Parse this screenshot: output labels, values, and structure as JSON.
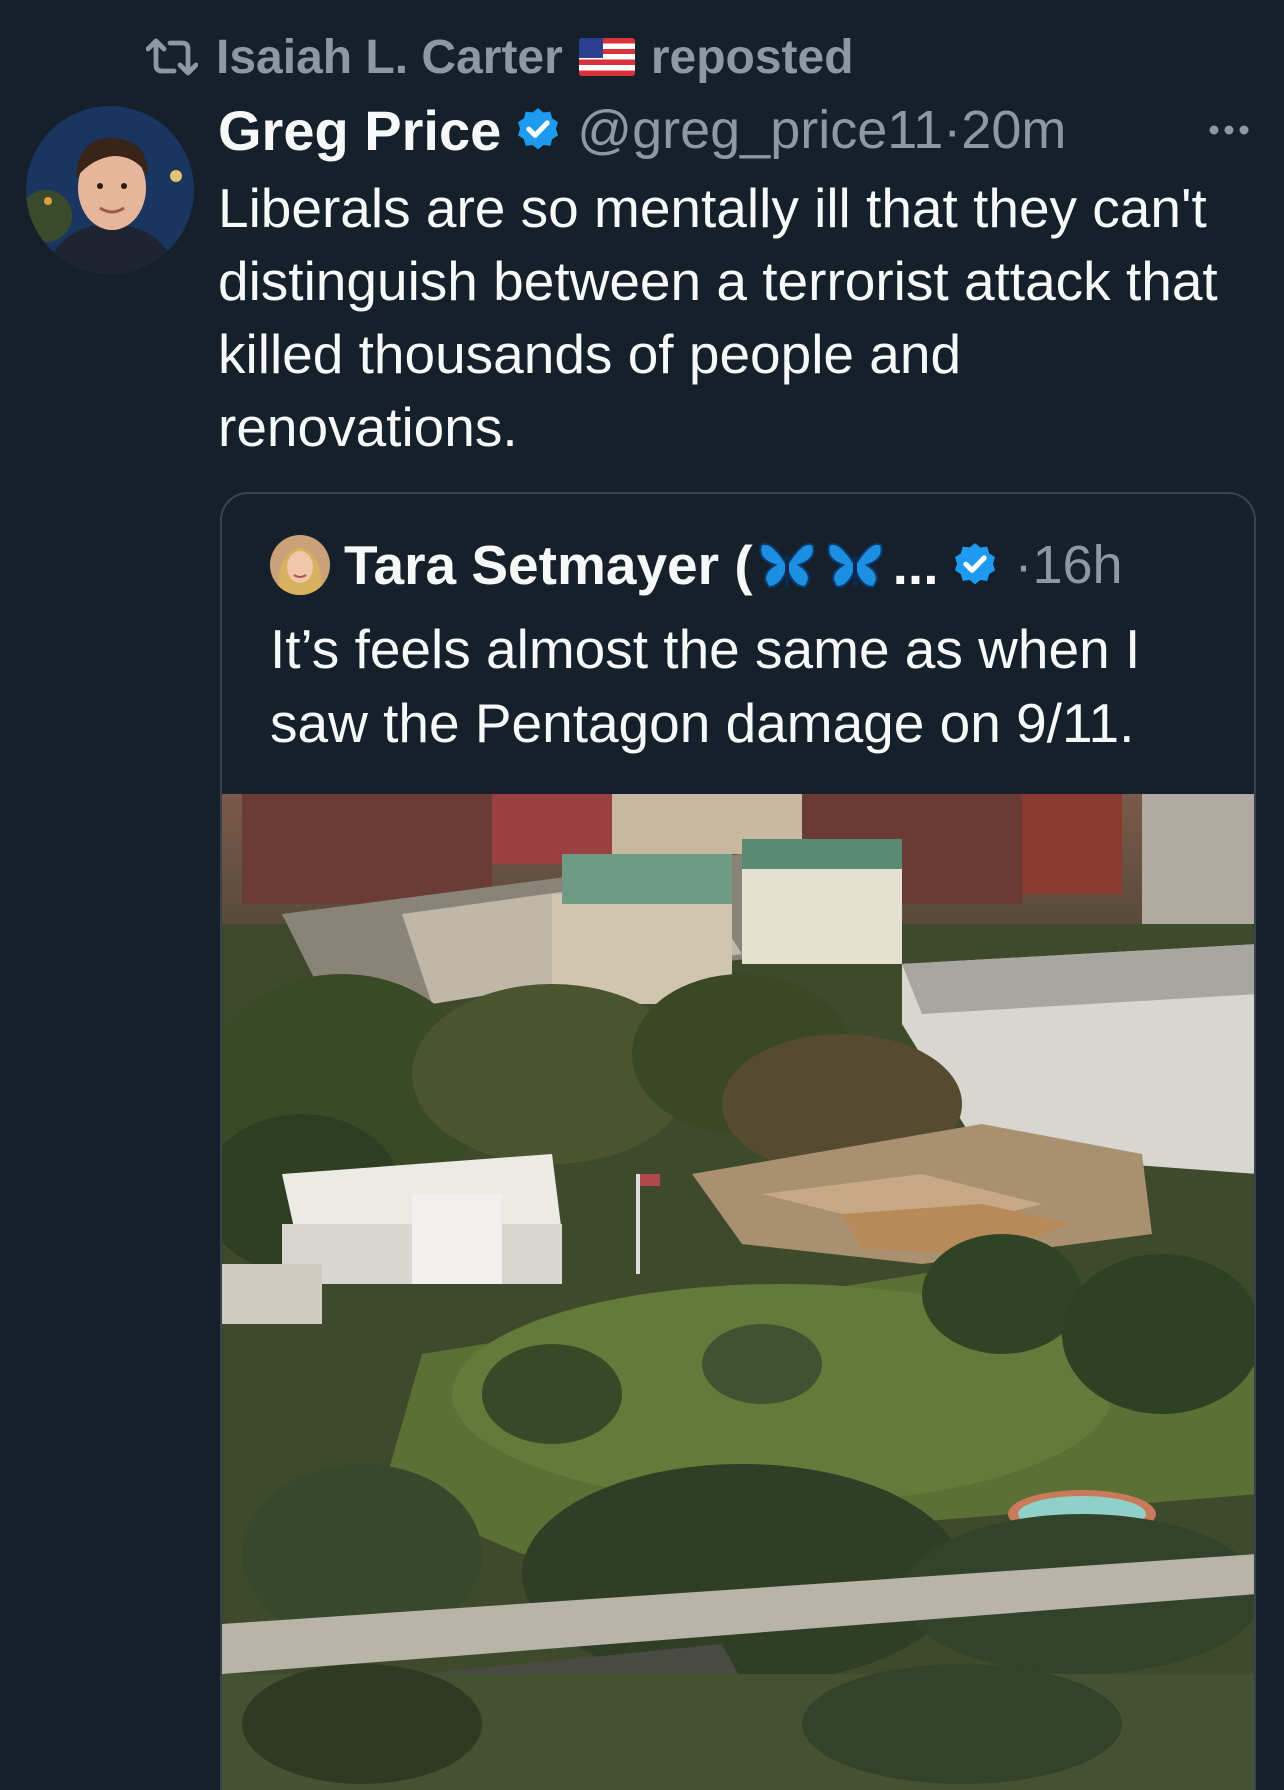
{
  "repost": {
    "reposter_name": "Isaiah L. Carter",
    "label": "reposted",
    "icon": "repost-icon",
    "emoji": "us-flag"
  },
  "tweet": {
    "author_name": "Greg Price",
    "verified": true,
    "handle": "@greg_price11",
    "separator": "·",
    "time": "20m",
    "text": "Liberals are so mentally ill that they can't distinguish between a terrorist attack that killed thousands of people and renovations."
  },
  "quote": {
    "author_name": "Tara Setmayer (",
    "name_suffix": "...",
    "verified": true,
    "separator": "·",
    "time": "16h",
    "text": "It’s feels almost the same as when I saw the Pentagon damage on 9/11.",
    "emojis": [
      "butterfly",
      "butterfly"
    ],
    "media": "aerial-photo-white-house-demolition"
  },
  "colors": {
    "background": "#15202b",
    "text": "#f7f9f9",
    "secondary": "#8b98a5",
    "verified_blue": "#1d9bf0",
    "border": "#38444d"
  }
}
